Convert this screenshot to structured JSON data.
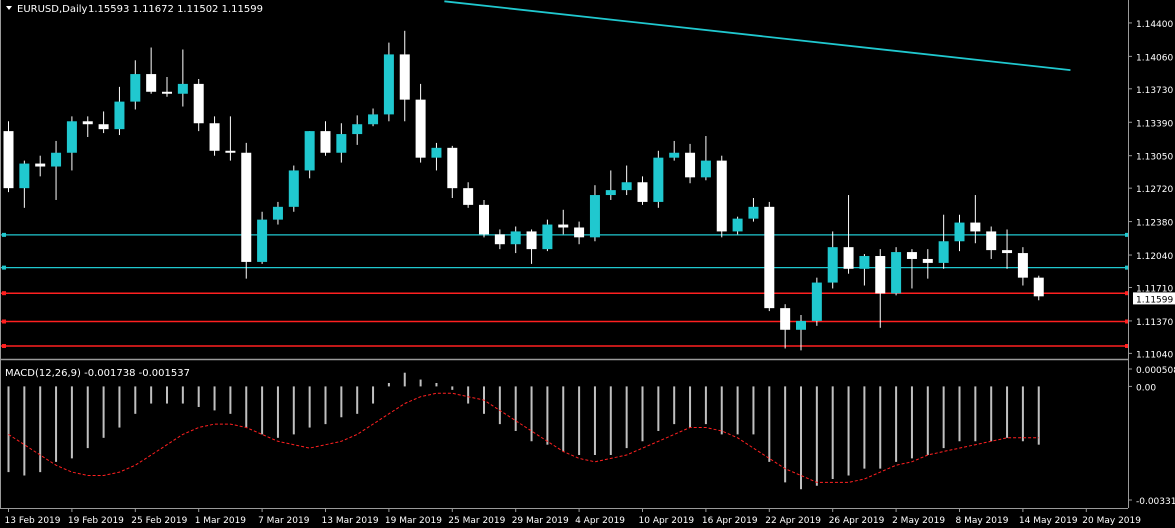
{
  "header": {
    "symbol": "EURUSD,Daily",
    "ohlc": "1.15593 1.11672 1.11502 1.11599"
  },
  "indicator": {
    "label": "MACD(12,26,9) -0.001738 -0.001537"
  },
  "colors": {
    "background": "#000000",
    "bull_body": "#20c8cf",
    "bear_body": "#ffffff",
    "wick": "#ffffff",
    "trend_line": "#20c8cf",
    "support_line": "#20c8cf",
    "resistance_line": "#ff2020",
    "macd_hist": "#c0c0c0",
    "macd_signal": "#ff2020",
    "axis_text": "#ffffff",
    "separator": "#9a9a9a"
  },
  "chart_data": {
    "type": "candlestick",
    "price_axis": {
      "ticks": [
        1.144,
        1.1406,
        1.1373,
        1.1339,
        1.1305,
        1.1272,
        1.1238,
        1.1204,
        1.1171,
        1.1137,
        1.1104
      ],
      "tick_labels": [
        "1.14400",
        "1.14060",
        "1.13730",
        "1.13390",
        "1.13050",
        "1.12720",
        "1.12380",
        "1.12040",
        "1.11710",
        "1.11370",
        "1.11040"
      ],
      "range": [
        1.10993,
        1.14623
      ],
      "current_price_label": "1.11599",
      "current_price": 1.11599
    },
    "macd_axis": {
      "tick_labels": [
        "0.000508",
        "0.00",
        "-0.003314"
      ],
      "ticks": [
        0.000508,
        0.0,
        -0.003314
      ]
    },
    "date_labels": [
      {
        "bar": 0,
        "text": "13 Feb 2019"
      },
      {
        "bar": 4,
        "text": "19 Feb 2019"
      },
      {
        "bar": 8,
        "text": "25 Feb 2019"
      },
      {
        "bar": 12,
        "text": "1 Mar 2019"
      },
      {
        "bar": 16,
        "text": "7 Mar 2019"
      },
      {
        "bar": 20,
        "text": "13 Mar 2019"
      },
      {
        "bar": 24,
        "text": "19 Mar 2019"
      },
      {
        "bar": 28,
        "text": "25 Mar 2019"
      },
      {
        "bar": 32,
        "text": "29 Mar 2019"
      },
      {
        "bar": 36,
        "text": "4 Apr 2019"
      },
      {
        "bar": 40,
        "text": "10 Apr 2019"
      },
      {
        "bar": 44,
        "text": "16 Apr 2019"
      },
      {
        "bar": 48,
        "text": "22 Apr 2019"
      },
      {
        "bar": 52,
        "text": "26 Apr 2019"
      },
      {
        "bar": 56,
        "text": "2 May 2019"
      },
      {
        "bar": 60,
        "text": "8 May 2019"
      },
      {
        "bar": 64,
        "text": "14 May 2019"
      },
      {
        "bar": 68,
        "text": "20 May 2019"
      }
    ],
    "candles": [
      [
        1.133,
        1.134,
        1.1268,
        1.1272
      ],
      [
        1.1272,
        1.13,
        1.1252,
        1.1297
      ],
      [
        1.1297,
        1.1305,
        1.1284,
        1.1294
      ],
      [
        1.1294,
        1.132,
        1.126,
        1.1308
      ],
      [
        1.1308,
        1.1345,
        1.129,
        1.134
      ],
      [
        1.134,
        1.1345,
        1.1324,
        1.1337
      ],
      [
        1.1337,
        1.135,
        1.1328,
        1.1332
      ],
      [
        1.1332,
        1.1375,
        1.1326,
        1.136
      ],
      [
        1.136,
        1.1402,
        1.1352,
        1.1388
      ],
      [
        1.1388,
        1.1415,
        1.1368,
        1.137
      ],
      [
        1.137,
        1.1385,
        1.1365,
        1.1368
      ],
      [
        1.1368,
        1.1413,
        1.1355,
        1.1378
      ],
      [
        1.1378,
        1.1383,
        1.133,
        1.1338
      ],
      [
        1.1338,
        1.1345,
        1.1305,
        1.131
      ],
      [
        1.131,
        1.1345,
        1.13,
        1.1308
      ],
      [
        1.1308,
        1.1318,
        1.118,
        1.1197
      ],
      [
        1.1197,
        1.1248,
        1.1195,
        1.124
      ],
      [
        1.124,
        1.1258,
        1.1235,
        1.1253
      ],
      [
        1.1253,
        1.1295,
        1.1248,
        1.129
      ],
      [
        1.129,
        1.133,
        1.1282,
        1.133
      ],
      [
        1.133,
        1.134,
        1.1305,
        1.1308
      ],
      [
        1.1308,
        1.1338,
        1.1298,
        1.1327
      ],
      [
        1.1327,
        1.1346,
        1.1316,
        1.1337
      ],
      [
        1.1337,
        1.1353,
        1.1335,
        1.1347
      ],
      [
        1.1347,
        1.142,
        1.134,
        1.1408
      ],
      [
        1.1408,
        1.1432,
        1.134,
        1.1362
      ],
      [
        1.1362,
        1.1378,
        1.1298,
        1.1303
      ],
      [
        1.1303,
        1.1318,
        1.129,
        1.1313
      ],
      [
        1.1313,
        1.1315,
        1.1262,
        1.1272
      ],
      [
        1.1272,
        1.1278,
        1.1252,
        1.1255
      ],
      [
        1.1255,
        1.126,
        1.1222,
        1.1225
      ],
      [
        1.1225,
        1.123,
        1.121,
        1.1215
      ],
      [
        1.1215,
        1.1233,
        1.1206,
        1.1228
      ],
      [
        1.1228,
        1.123,
        1.1195,
        1.121
      ],
      [
        1.121,
        1.124,
        1.1208,
        1.1235
      ],
      [
        1.1235,
        1.125,
        1.1225,
        1.1232
      ],
      [
        1.1232,
        1.1238,
        1.1215,
        1.1222
      ],
      [
        1.1222,
        1.1275,
        1.1218,
        1.1265
      ],
      [
        1.1265,
        1.129,
        1.126,
        1.127
      ],
      [
        1.127,
        1.1295,
        1.1265,
        1.1278
      ],
      [
        1.1278,
        1.1284,
        1.1255,
        1.1258
      ],
      [
        1.1258,
        1.131,
        1.1252,
        1.1303
      ],
      [
        1.1303,
        1.132,
        1.13,
        1.1308
      ],
      [
        1.1308,
        1.1317,
        1.1277,
        1.1283
      ],
      [
        1.1283,
        1.1325,
        1.128,
        1.13
      ],
      [
        1.13,
        1.1305,
        1.1222,
        1.1228
      ],
      [
        1.1228,
        1.1243,
        1.1225,
        1.1241
      ],
      [
        1.1241,
        1.1262,
        1.1238,
        1.1253
      ],
      [
        1.1253,
        1.1258,
        1.1147,
        1.115
      ],
      [
        1.115,
        1.1154,
        1.1109,
        1.1128
      ],
      [
        1.1128,
        1.1143,
        1.1107,
        1.1137
      ],
      [
        1.1137,
        1.1181,
        1.1132,
        1.1176
      ],
      [
        1.1176,
        1.1228,
        1.117,
        1.1212
      ],
      [
        1.1212,
        1.1265,
        1.1185,
        1.119
      ],
      [
        1.119,
        1.1205,
        1.1173,
        1.1203
      ],
      [
        1.1203,
        1.121,
        1.113,
        1.1165
      ],
      [
        1.1165,
        1.1212,
        1.1163,
        1.1207
      ],
      [
        1.1207,
        1.121,
        1.117,
        1.12
      ],
      [
        1.12,
        1.121,
        1.118,
        1.1196
      ],
      [
        1.1196,
        1.1245,
        1.119,
        1.1218
      ],
      [
        1.1218,
        1.1245,
        1.1208,
        1.1237
      ],
      [
        1.1237,
        1.1265,
        1.1216,
        1.1228
      ],
      [
        1.1228,
        1.1233,
        1.12,
        1.1209
      ],
      [
        1.1209,
        1.123,
        1.119,
        1.1206
      ],
      [
        1.1206,
        1.1212,
        1.1173,
        1.1181
      ],
      [
        1.1181,
        1.1183,
        1.1158,
        1.1162
      ]
    ],
    "trend_line": {
      "from": [
        27.5,
        1.1462
      ],
      "to": [
        67,
        1.1392
      ]
    },
    "support_lines": [
      1.12245,
      1.11912
    ],
    "resistance_lines": [
      1.11652,
      1.11364,
      1.11115
    ],
    "macd_histogram": [
      -0.0025,
      -0.0026,
      -0.0025,
      -0.0022,
      -0.0021,
      -0.0018,
      -0.0015,
      -0.0012,
      -0.0008,
      -0.0005,
      -0.0005,
      -0.0005,
      -0.0006,
      -0.0007,
      -0.0008,
      -0.0012,
      -0.0014,
      -0.0015,
      -0.0014,
      -0.0012,
      -0.0011,
      -0.0009,
      -0.0008,
      -0.0005,
      0.0001,
      0.0004,
      0.0002,
      0.0001,
      -0.0001,
      -0.0005,
      -0.0008,
      -0.0011,
      -0.0013,
      -0.0016,
      -0.0017,
      -0.0019,
      -0.002,
      -0.002,
      -0.002,
      -0.0018,
      -0.0016,
      -0.0013,
      -0.0011,
      -0.0012,
      -0.0011,
      -0.0014,
      -0.0014,
      -0.0014,
      -0.0022,
      -0.0028,
      -0.003,
      -0.0029,
      -0.0027,
      -0.0026,
      -0.0024,
      -0.0024,
      -0.0022,
      -0.0021,
      -0.002,
      -0.0018,
      -0.0016,
      -0.0016,
      -0.0016,
      -0.0015,
      -0.0016,
      -0.0017
    ],
    "macd_signal": [
      -0.0014,
      -0.0017,
      -0.002,
      -0.0023,
      -0.0025,
      -0.0026,
      -0.0026,
      -0.0025,
      -0.0023,
      -0.002,
      -0.0017,
      -0.0014,
      -0.0012,
      -0.0011,
      -0.0011,
      -0.0012,
      -0.0014,
      -0.0016,
      -0.0017,
      -0.0018,
      -0.0017,
      -0.0016,
      -0.0014,
      -0.0011,
      -0.0008,
      -0.0005,
      -0.0003,
      -0.0002,
      -0.0002,
      -0.0003,
      -0.0004,
      -0.0007,
      -0.001,
      -0.0013,
      -0.0016,
      -0.0019,
      -0.0021,
      -0.0022,
      -0.0021,
      -0.002,
      -0.0018,
      -0.0016,
      -0.0014,
      -0.0012,
      -0.0012,
      -0.0013,
      -0.0015,
      -0.0018,
      -0.0021,
      -0.0024,
      -0.0026,
      -0.0028,
      -0.0028,
      -0.0028,
      -0.0027,
      -0.0025,
      -0.0023,
      -0.0022,
      -0.002,
      -0.0019,
      -0.0018,
      -0.0017,
      -0.0016,
      -0.0015,
      -0.0015,
      -0.0015
    ]
  }
}
